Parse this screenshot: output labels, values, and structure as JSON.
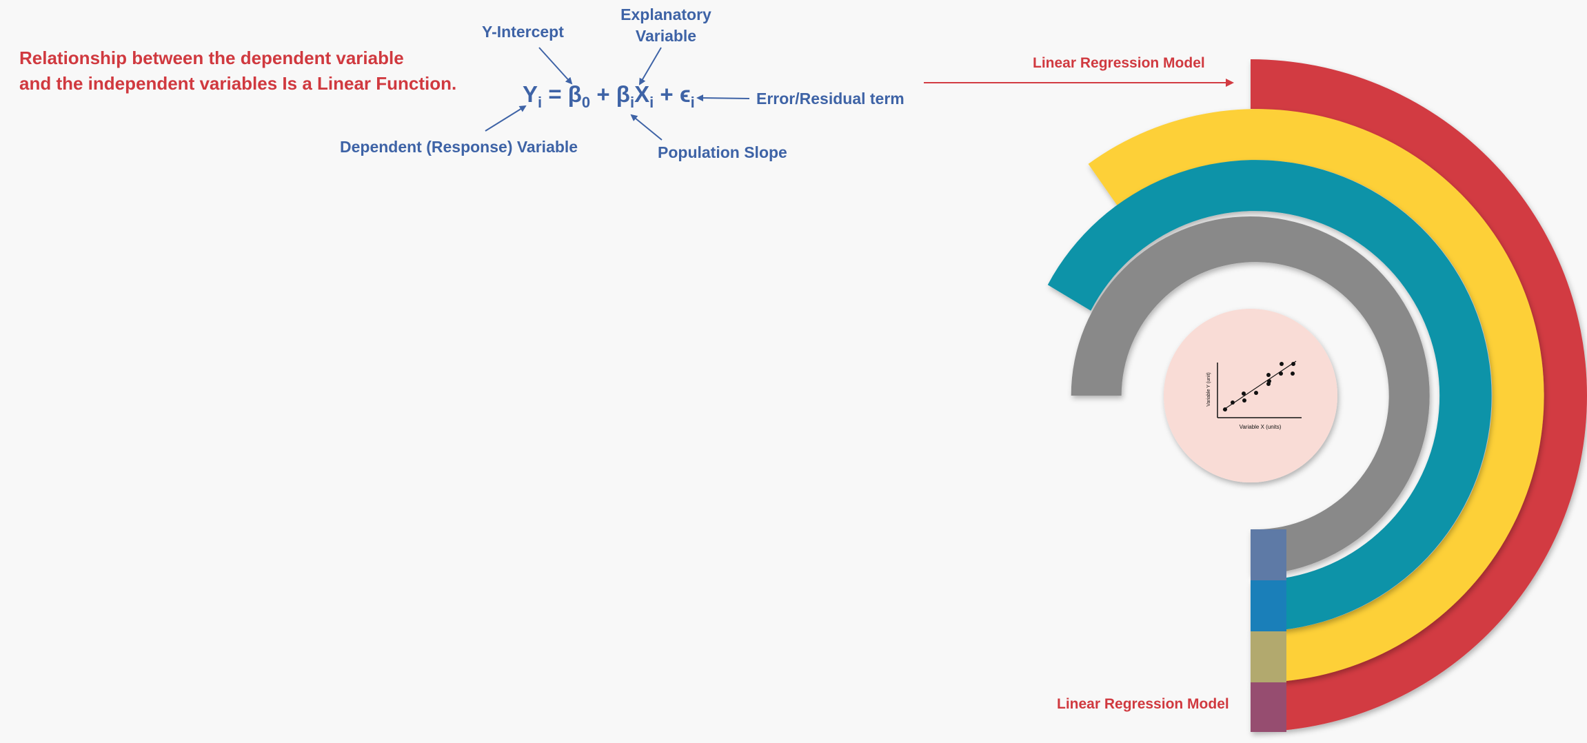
{
  "headline": {
    "line1": "Relationship between the dependent variable",
    "line2": "and the independent variables Is a Linear Function."
  },
  "formula": {
    "y": "Y",
    "y_sub": "i",
    "eq": "=",
    "beta0": "β",
    "beta0_sub": "0",
    "plus1": "+",
    "beta1": "β",
    "beta1_sub": "i",
    "x": "X",
    "x_sub": "i",
    "plus2": "+",
    "eps": "ϵ",
    "eps_sub": "i"
  },
  "labels": {
    "y_intercept": "Y-Intercept",
    "explanatory_line1": "Explanatory",
    "explanatory_line2": "Variable",
    "error_term": "Error/Residual  term",
    "dependent": "Dependent  (Response)  Variable",
    "slope": "Population  Slope"
  },
  "model_labels": {
    "top": "Linear Regression Model",
    "bottom": "Linear Regression Model"
  },
  "inner_chart": {
    "x_label": "Variable X (units)",
    "y_label": "Variable Y (unit)"
  },
  "colors": {
    "red": "#d23b42",
    "yellow": "#fdd037",
    "teal": "#0893a8",
    "gray": "#898989",
    "center": "#f9dcd6",
    "blue_text": "#3e63a6"
  }
}
